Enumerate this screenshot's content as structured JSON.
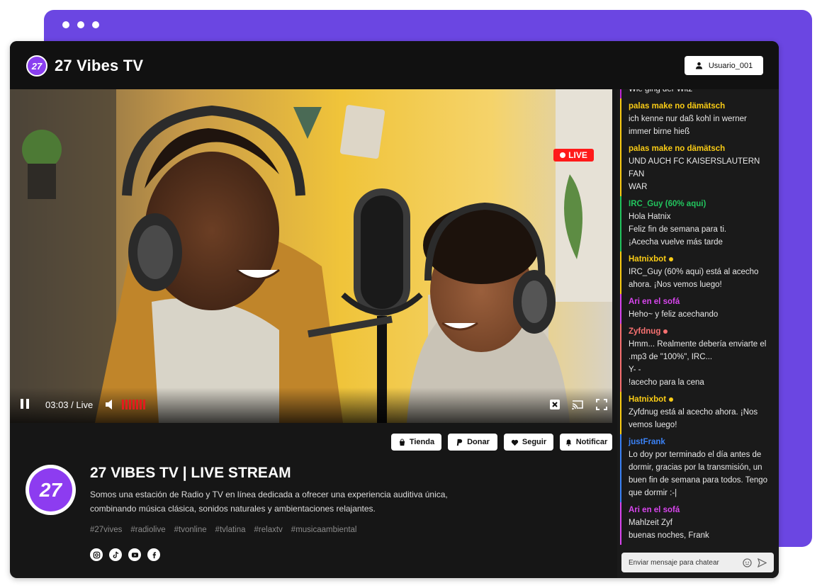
{
  "app": {
    "brand": "27 Vibes TV",
    "logo_text": "27"
  },
  "header": {
    "user_label": "Usuario_001"
  },
  "video": {
    "live_label": "LIVE",
    "time": "03:03 / Live",
    "volume_level": 0.7
  },
  "chat": {
    "messages": [
      {
        "user": "",
        "color": "#c026d3",
        "lines": [
          "Wie ging der Witz"
        ]
      },
      {
        "user": "palas make no dämätsch",
        "color": "#facc15",
        "lines": [
          "ich kenne nur daß kohl in werner",
          "immer birne hieß"
        ]
      },
      {
        "user": "palas make no dämätsch",
        "color": "#facc15",
        "lines": [
          "UND AUCH FC KAISERSLAUTERN FAN",
          "WAR"
        ]
      },
      {
        "user": "IRC_Guy (60% aqui)",
        "color": "#22c55e",
        "lines": [
          "Hola Hatnix",
          "Feliz fin de semana para ti.",
          "¡Acecha vuelve más tarde"
        ]
      },
      {
        "user": "Hatnixbot",
        "color": "#facc15",
        "badge": "#facc15",
        "lines": [
          "IRC_Guy (60% aqui) está al acecho",
          "ahora. ¡Nos vemos luego!"
        ]
      },
      {
        "user": "Ari en el sofá",
        "color": "#d946ef",
        "lines": [
          "Heho~ y feliz acechando"
        ]
      },
      {
        "user": "Zyfdnug",
        "color": "#f87171",
        "badge": "#f87171",
        "lines": [
          "Hmm... Realmente debería enviarte el",
          ".mp3 de \"100%\", IRC...",
          "Y- -",
          "!acecho para la cena"
        ]
      },
      {
        "user": "Hatnixbot",
        "color": "#facc15",
        "badge": "#facc15",
        "lines": [
          "Zyfdnug está al acecho ahora. ¡Nos",
          "vemos luego!"
        ]
      },
      {
        "user": "justFrank",
        "color": "#3b82f6",
        "lines": [
          "Lo doy por terminado el día antes de",
          "dormir, gracias por la transmisión, un",
          "buen fin de semana para todos. Tengo",
          "que dormir :-|"
        ]
      },
      {
        "user": "Ari en el sofá",
        "color": "#d946ef",
        "lines": [
          "Mahlzeit Zyf",
          "buenas noches, Frank"
        ]
      }
    ],
    "input_placeholder": "Enviar mensaje para chatear"
  },
  "actions": {
    "shop": "Tienda",
    "donate": "Donar",
    "follow": "Seguir",
    "notify": "Notificar"
  },
  "channel": {
    "avatar_text": "27",
    "title": "27 VIBES TV | LIVE STREAM",
    "description": "Somos una estación de Radio y TV en línea dedicada a ofrecer una experiencia auditiva única, combinando música clásica, sonidos naturales y ambientaciones relajantes.",
    "tags": [
      "#27vives",
      "#radiolive",
      "#tvonline",
      "#tvlatina",
      "#relaxtv",
      "#musicaambiental"
    ]
  },
  "social": [
    "instagram-icon",
    "tiktok-icon",
    "youtube-icon",
    "facebook-icon"
  ]
}
